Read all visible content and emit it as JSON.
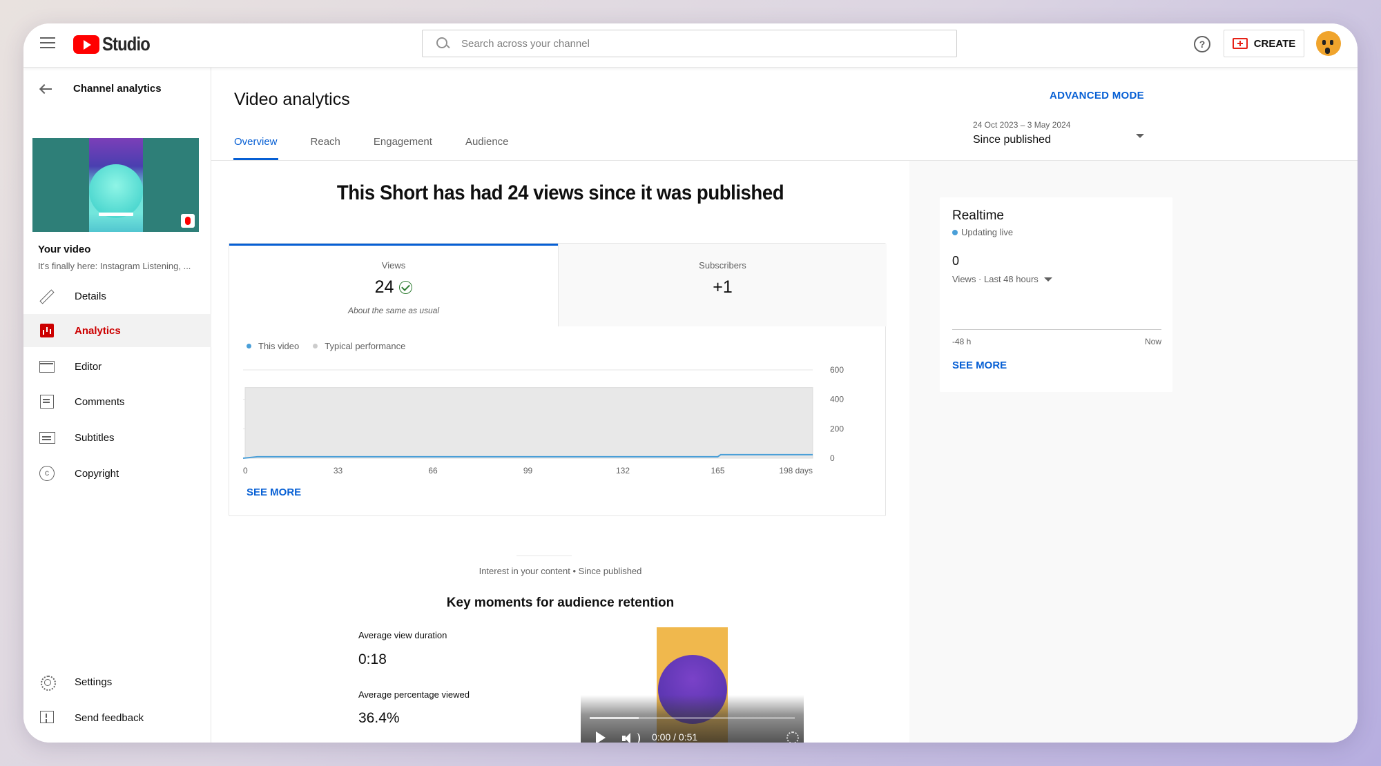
{
  "header": {
    "app_name": "Studio",
    "search_placeholder": "Search across your channel",
    "create_label": "CREATE"
  },
  "sidebar": {
    "back_label": "Channel analytics",
    "your_video_label": "Your video",
    "video_title": "It's finally here: Instagram Listening, ...",
    "items": [
      {
        "label": "Details",
        "icon": "pencil-icon"
      },
      {
        "label": "Analytics",
        "icon": "analytics-icon",
        "active": true
      },
      {
        "label": "Editor",
        "icon": "editor-icon"
      },
      {
        "label": "Comments",
        "icon": "comments-icon"
      },
      {
        "label": "Subtitles",
        "icon": "subtitles-icon"
      },
      {
        "label": "Copyright",
        "icon": "copyright-icon"
      }
    ],
    "bottom_items": [
      {
        "label": "Settings",
        "icon": "gear-icon"
      },
      {
        "label": "Send feedback",
        "icon": "feedback-icon"
      }
    ]
  },
  "main": {
    "title": "Video analytics",
    "advanced_mode": "ADVANCED MODE",
    "tabs": [
      {
        "label": "Overview",
        "active": true
      },
      {
        "label": "Reach"
      },
      {
        "label": "Engagement"
      },
      {
        "label": "Audience"
      }
    ],
    "date_range": "24 Oct 2023 – 3 May 2024",
    "date_label": "Since published",
    "headline": "This Short has had 24 views since it was published",
    "metrics": [
      {
        "name": "Views",
        "value": "24",
        "note": "About the same as usual"
      },
      {
        "name": "Subscribers",
        "value": "+1"
      }
    ],
    "legend": [
      {
        "label": "This video",
        "color": "#4a9fd8"
      },
      {
        "label": "Typical performance",
        "color": "#cccccc"
      }
    ],
    "see_more": "SEE MORE",
    "interest_label": "Interest in your content • Since published",
    "key_moments_title": "Key moments for audience retention",
    "avg_view_duration_label": "Average view duration",
    "avg_view_duration": "0:18",
    "avg_pct_label": "Average percentage viewed",
    "avg_pct": "36.4%",
    "player_time": "0:00 / 0:51",
    "player_progress": 0.24
  },
  "realtime": {
    "title": "Realtime",
    "status": "Updating live",
    "value": "0",
    "sub_label": "Views · Last 48 hours",
    "axis_start": "-48 h",
    "axis_end": "Now",
    "see_more": "SEE MORE"
  },
  "chart_data": {
    "type": "area",
    "x_ticks": [
      "0",
      "33",
      "66",
      "99",
      "132",
      "165",
      "198 days"
    ],
    "y_ticks": [
      "0",
      "200",
      "400",
      "600"
    ],
    "xlim": [
      0,
      198
    ],
    "ylim": [
      0,
      600
    ],
    "series": [
      {
        "name": "This video",
        "color": "#4a9fd8",
        "x": [
          0,
          5,
          165,
          166,
          198
        ],
        "y": [
          0,
          10,
          10,
          24,
          24
        ]
      },
      {
        "name": "Typical performance",
        "color": "#e8e8e8",
        "x": [
          0,
          198
        ],
        "y_low": [
          0,
          0
        ],
        "y_high": [
          480,
          480
        ]
      }
    ],
    "legend_position": "top-left",
    "grid": true
  }
}
